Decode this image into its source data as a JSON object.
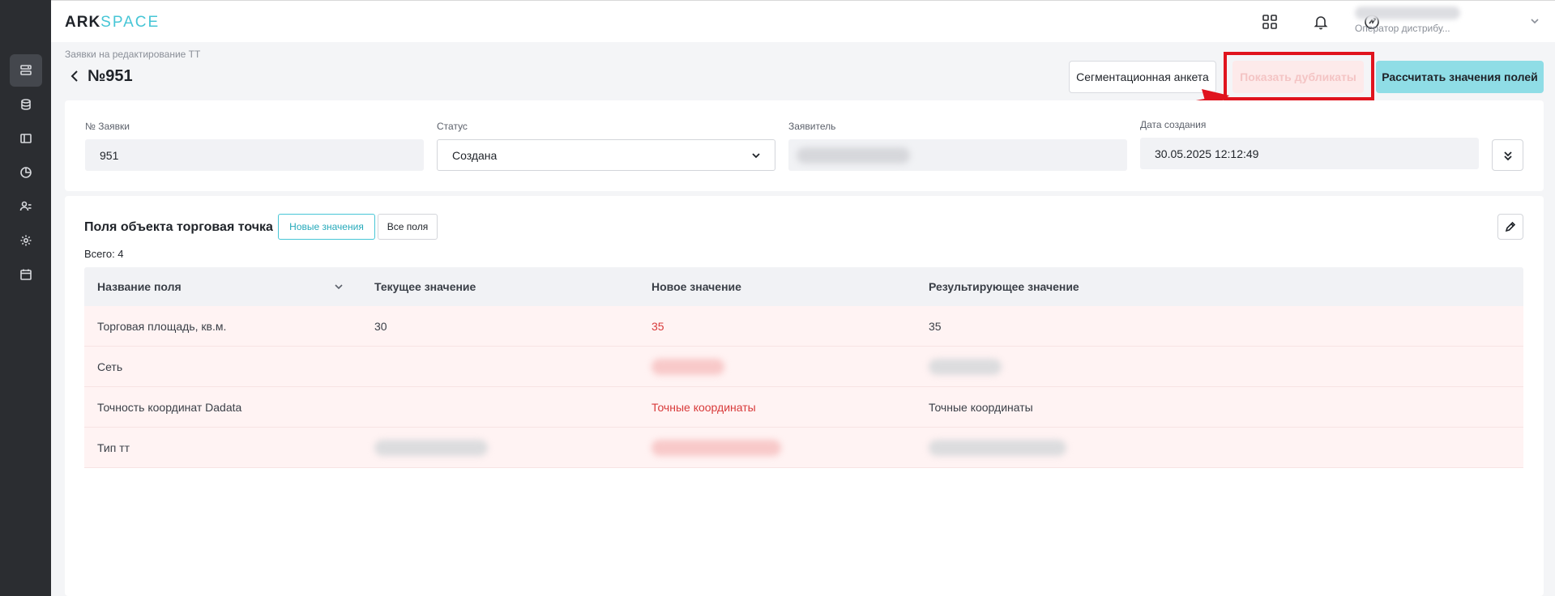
{
  "logo": {
    "part1": "ARK",
    "part2": "SPACE"
  },
  "header": {
    "user_role": "Оператор дистрибу..."
  },
  "breadcrumb": "Заявки на редактирование ТТ",
  "page_title": "№951",
  "actions": {
    "segmentation": "Сегментационная анкета",
    "show_duplicates": "Показать дубликаты",
    "calculate": "Рассчитать значения полей"
  },
  "request": {
    "number_label": "№ Заявки",
    "number_value": "951",
    "status_label": "Статус",
    "status_value": "Создана",
    "applicant_label": "Заявитель",
    "created_label": "Дата создания",
    "created_value": "30.05.2025 12:12:49"
  },
  "fields_section": {
    "title": "Поля объекта торговая точка",
    "tab_new": "Новые значения",
    "tab_all": "Все поля",
    "total": "Всего: 4"
  },
  "table": {
    "columns": [
      "Название поля",
      "Текущее значение",
      "Новое значение",
      "Результирующее значение"
    ],
    "rows": [
      {
        "name": "Торговая площадь, кв.м.",
        "current": "30",
        "new": "35",
        "result": "35"
      },
      {
        "name": "Сеть",
        "current": "",
        "new": "",
        "result": ""
      },
      {
        "name": "Точность координат Dadata",
        "current": "",
        "new": "Точные координаты",
        "result": "Точные координаты"
      },
      {
        "name": "Тип тт",
        "current": "",
        "new": "",
        "result": ""
      }
    ]
  },
  "colors": {
    "accent": "#47c6d6",
    "sidebar": "#2b2d31",
    "highlight": "#e0141e",
    "row_highlight": "#fff3f3",
    "new_value": "#d83a3a"
  }
}
